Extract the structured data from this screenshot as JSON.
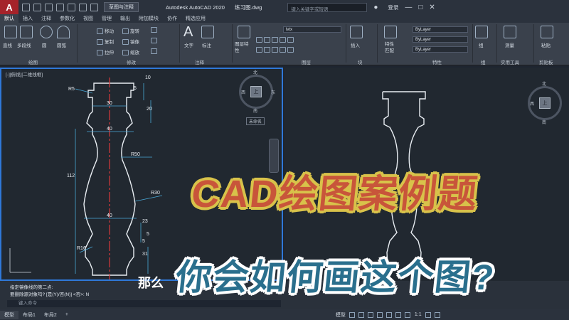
{
  "titlebar": {
    "logo": "A",
    "workspace": "草图与注释",
    "app_title": "Autodesk AutoCAD 2020",
    "drawing": "练习图.dwg",
    "search_placeholder": "键入关键字或短语",
    "login": "登录",
    "minimize": "—",
    "maximize": "□",
    "close": "✕"
  },
  "tabs": [
    "默认",
    "插入",
    "注释",
    "参数化",
    "视图",
    "管理",
    "输出",
    "附加模块",
    "协作",
    "精选应用"
  ],
  "ribbon": {
    "draw": {
      "tools": [
        "直线",
        "多段线",
        "圆",
        "圆弧"
      ],
      "label": "绘图"
    },
    "modify": {
      "tools": [
        "移动",
        "旋转",
        "复制",
        "镜像",
        "拉伸",
        "缩放"
      ],
      "label": "修改"
    },
    "annotation": {
      "tools": [
        "文字",
        "标注"
      ],
      "label": "注释"
    },
    "layers": {
      "tools": [
        "图层特性"
      ],
      "current": "lvtx",
      "label": "图层"
    },
    "block": {
      "tools": [
        "插入"
      ],
      "label": "块"
    },
    "properties": {
      "tools": [
        "特性匹配"
      ],
      "values": [
        "ByLayer",
        "ByLayer",
        "ByLayer"
      ],
      "label": "特性"
    },
    "groups": {
      "tools": [
        "组"
      ],
      "label": "组"
    },
    "utilities": {
      "tools": [
        "测量"
      ],
      "label": "实用工具"
    },
    "clipboard": {
      "tools": [
        "粘贴"
      ],
      "label": "剪贴板"
    }
  },
  "viewport_left": {
    "label": "[-][俯视][二维线框]",
    "compass": {
      "n": "北",
      "s": "南",
      "e": "东",
      "w": "西",
      "top": "上"
    },
    "ucs": "未命名"
  },
  "viewport_right": {
    "compass": {
      "n": "北",
      "s": "南",
      "w": "西",
      "top": "上"
    }
  },
  "drawing": {
    "dims": [
      "10",
      "5",
      "30",
      "20",
      "40",
      "R50",
      "112",
      "R30",
      "40",
      "23",
      "5",
      "5",
      "31",
      "R16",
      "R5",
      "30"
    ]
  },
  "command": {
    "lines": [
      "指定镜像线的第二点:",
      "要删除源对象吗? [是(Y)/否(N)] <否>: N"
    ],
    "input_placeholder": "键入命令"
  },
  "status": {
    "tabs": [
      "模型",
      "布局1",
      "布局2"
    ],
    "right_model": "模型",
    "scale": "1:1"
  },
  "overlay": {
    "headline_a": "CAD",
    "headline_b": "绘图案例题",
    "question": "你会如何画这个图?",
    "subtitle": "那么"
  }
}
